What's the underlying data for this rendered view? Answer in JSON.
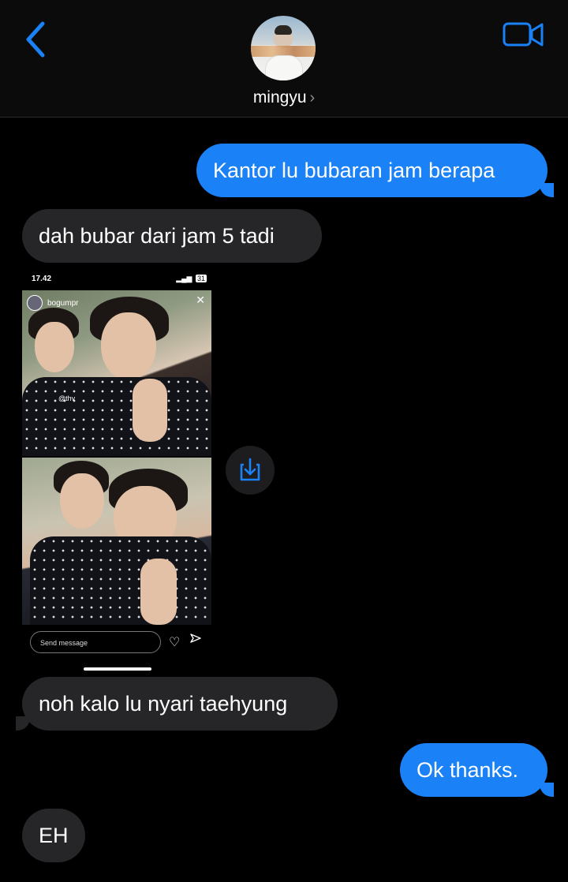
{
  "header": {
    "contact_name": "mingyu",
    "chevron": "›"
  },
  "icons": {
    "back": "chevron-left-icon",
    "video": "video-camera-icon",
    "share": "save-download-icon"
  },
  "colors": {
    "accent": "#1a82f6",
    "incoming_bubble": "#262628",
    "background": "#000000"
  },
  "messages": [
    {
      "direction": "outgoing",
      "text": "Kantor lu bubaran jam berapa"
    },
    {
      "direction": "incoming",
      "text": "dah bubar dari jam 5 tadi"
    },
    {
      "direction": "incoming",
      "type": "image"
    },
    {
      "direction": "incoming",
      "text": "noh kalo lu nyari taehyung"
    },
    {
      "direction": "outgoing",
      "text": "Ok thanks."
    },
    {
      "direction": "incoming",
      "text": "EH"
    }
  ],
  "screenshot": {
    "status_time": "17.42",
    "battery": "31",
    "story_username": "bogumpr",
    "mention": "@thv",
    "message_placeholder": "Send message"
  }
}
